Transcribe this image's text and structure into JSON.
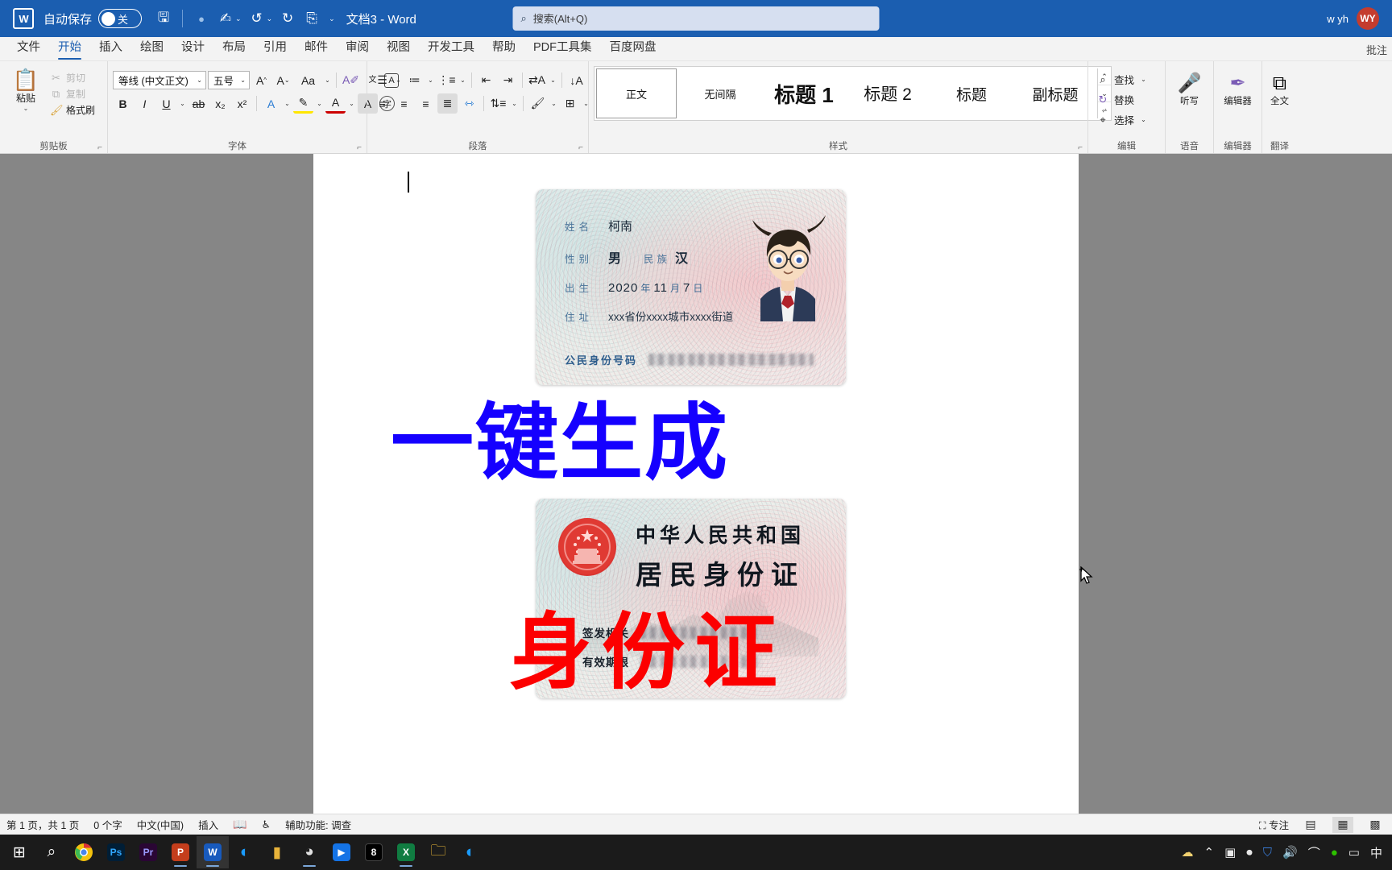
{
  "titlebar": {
    "app_icon": "word-logo-icon",
    "autosave_label": "自动保存",
    "autosave_state": "关",
    "save_icon": "save-icon",
    "undo_icon": "undo-icon",
    "redo_icon": "redo-icon",
    "touch_icon": "touch-mode-icon",
    "customize_icon": "customize-quick-access-icon",
    "doc_title": "文档3 - Word",
    "search_placeholder": "搜索(Alt+Q)",
    "search_value": "",
    "search_icon": "search-icon",
    "user_name": "w yh",
    "user_initials": "WY",
    "bg_color": "#1b5eb0"
  },
  "tabs": [
    {
      "label": "文件",
      "active": false
    },
    {
      "label": "开始",
      "active": true
    },
    {
      "label": "插入",
      "active": false
    },
    {
      "label": "绘图",
      "active": false
    },
    {
      "label": "设计",
      "active": false
    },
    {
      "label": "布局",
      "active": false
    },
    {
      "label": "引用",
      "active": false
    },
    {
      "label": "邮件",
      "active": false
    },
    {
      "label": "审阅",
      "active": false
    },
    {
      "label": "视图",
      "active": false
    },
    {
      "label": "开发工具",
      "active": false
    },
    {
      "label": "帮助",
      "active": false
    },
    {
      "label": "PDF工具集",
      "active": false
    },
    {
      "label": "百度网盘",
      "active": false
    }
  ],
  "tabs_right": {
    "comments_label": "批注"
  },
  "ribbon": {
    "clipboard": {
      "group_label": "剪贴板",
      "paste_label": "粘贴",
      "paste_icon": "paste-icon",
      "cut_label": "剪切",
      "cut_icon": "scissors-icon",
      "copy_label": "复制",
      "copy_icon": "copy-icon",
      "format_painter_label": "格式刷",
      "format_painter_icon": "format-painter-icon",
      "dialog_launcher": "⌟"
    },
    "font": {
      "group_label": "字体",
      "font_name": "等线 (中文正文)",
      "font_size": "五号",
      "grow_icon": "grow-font-icon",
      "shrink_icon": "shrink-font-icon",
      "change_case_icon": "change-case-icon",
      "clear_format_icon": "clear-formatting-icon",
      "phonetic_icon": "phonetic-guide-icon",
      "border_char_icon": "enclose-character-icon",
      "bold_label": "B",
      "italic_label": "I",
      "underline_label": "U",
      "strikethrough_icon": "strikethrough-icon",
      "subscript_label": "x₂",
      "superscript_label": "x²",
      "text_effects_icon": "text-effects-icon",
      "highlight_icon": "highlight-color-icon",
      "font_color_icon": "font-color-icon",
      "char_shading_icon": "character-shading-icon",
      "char_border_icon": "character-border-icon",
      "dialog_launcher": "⌟"
    },
    "paragraph": {
      "group_label": "段落",
      "bullets_icon": "bullet-list-icon",
      "numbering_icon": "numbered-list-icon",
      "multilevel_icon": "multilevel-list-icon",
      "decrease_indent_icon": "decrease-indent-icon",
      "increase_indent_icon": "increase-indent-icon",
      "cn_layout_icon": "asian-layout-icon",
      "sort_icon": "sort-icon",
      "show_marks_icon": "show-formatting-marks-icon",
      "align_left_icon": "align-left-icon",
      "align_center_icon": "align-center-icon",
      "align_right_icon": "align-right-icon",
      "justify_icon": "justify-icon",
      "distribute_icon": "distribute-icon",
      "line_spacing_icon": "line-spacing-icon",
      "shading_icon": "shading-icon",
      "borders_icon": "borders-icon",
      "dialog_launcher": "⌟"
    },
    "styles": {
      "group_label": "样式",
      "items": [
        {
          "label": "正文",
          "class": "s-zhengwen",
          "selected": true
        },
        {
          "label": "无间隔",
          "class": "s-wujiange",
          "selected": false
        },
        {
          "label": "标题 1",
          "class": "s-h1",
          "selected": false
        },
        {
          "label": "标题 2",
          "class": "s-h2",
          "selected": false
        },
        {
          "label": "标题",
          "class": "s-biaoti",
          "selected": false
        },
        {
          "label": "副标题",
          "class": "s-fubiaoti",
          "selected": false
        }
      ],
      "dialog_launcher": "⌟"
    },
    "editing": {
      "group_label": "编辑",
      "find_label": "查找",
      "find_icon": "search-icon",
      "replace_label": "替换",
      "replace_icon": "replace-icon",
      "select_label": "选择",
      "select_icon": "select-arrow-icon"
    },
    "voice": {
      "group_label": "语音",
      "dictate_label": "听写",
      "dictate_icon": "microphone-icon"
    },
    "editor": {
      "group_label": "编辑器",
      "editor_label": "编辑器",
      "editor_icon": "editor-pen-icon"
    },
    "share": {
      "group_label": "翻译",
      "share_label": "全文",
      "share_icon": "translate-icon"
    }
  },
  "document": {
    "overlay_text_1": "一键生成",
    "overlay_text_1_color": "#1500ff",
    "overlay_text_2": "身份证",
    "overlay_text_2_color": "#fc0000",
    "cursor_icon": "text-cursor-icon",
    "id_card_front": {
      "name_label": "姓名",
      "name_value": "柯南",
      "gender_label": "性别",
      "gender_value": "男",
      "ethnicity_label": "民族",
      "ethnicity_value": "汉",
      "birth_label": "出生",
      "birth_year": "2020",
      "birth_year_unit": "年",
      "birth_month": "11",
      "birth_month_unit": "月",
      "birth_day": "7",
      "birth_day_unit": "日",
      "address_label": "住址",
      "address_value": "xxx省份xxxx城市xxxx街道",
      "id_number_label": "公民身份号码",
      "id_number_value": "",
      "photo_alt": "portrait-photo"
    },
    "id_card_back": {
      "emblem_alt": "national-emblem-icon",
      "country_title": "中华人民共和国",
      "card_title": "居民身份证",
      "issuer_label": "签发机关",
      "issuer_value": "",
      "validity_label": "有效期限",
      "validity_value": ""
    }
  },
  "statusbar": {
    "page_info": "第 1 页，共 1 页",
    "word_count": "0 个字",
    "language": "中文(中国)",
    "insert_mode": "插入",
    "proofing_icon": "proofing-icon",
    "accessibility_icon": "accessibility-icon",
    "accessibility_label": "辅助功能: 调查",
    "focus_label": "专注",
    "focus_icon": "focus-icon",
    "view_read_icon": "read-mode-icon",
    "view_print_icon": "print-layout-icon",
    "view_web_icon": "web-layout-icon"
  },
  "taskbar": {
    "items": [
      {
        "name": "start-button",
        "glyph": "⊞",
        "bg": "transparent",
        "fg": "#ffffff",
        "open": false
      },
      {
        "name": "search-taskbar-icon",
        "glyph": "⌕",
        "bg": "transparent",
        "fg": "#ffffff",
        "open": false
      },
      {
        "name": "chrome-icon",
        "glyph": "◉",
        "bg": "transparent",
        "fg": "#4caf50",
        "open": false
      },
      {
        "name": "photoshop-icon",
        "glyph": "Ps",
        "bg": "#001e36",
        "fg": "#31a8ff",
        "open": false
      },
      {
        "name": "premiere-icon",
        "glyph": "Pr",
        "bg": "#2a0634",
        "fg": "#9999ff",
        "open": false
      },
      {
        "name": "powerpoint-icon",
        "glyph": "P",
        "bg": "#c43e1c",
        "fg": "#ffffff",
        "open": true
      },
      {
        "name": "word-icon",
        "glyph": "W",
        "bg": "#185abd",
        "fg": "#ffffff",
        "open": true,
        "running": true
      },
      {
        "name": "quark-browser-icon",
        "glyph": "◐",
        "bg": "transparent",
        "fg": "#1a9bfc",
        "open": false
      },
      {
        "name": "wps-icon",
        "glyph": "▮",
        "bg": "transparent",
        "fg": "#e8b33a",
        "open": false
      },
      {
        "name": "recorder-icon",
        "glyph": "◕",
        "bg": "transparent",
        "fg": "#e0e0e0",
        "open": true
      },
      {
        "name": "video-editor-icon",
        "glyph": "▶",
        "bg": "#1473e6",
        "fg": "#ffffff",
        "open": false
      },
      {
        "name": "capcut-icon",
        "glyph": "8",
        "bg": "#000000",
        "fg": "#ffffff",
        "open": false
      },
      {
        "name": "excel-icon",
        "glyph": "X",
        "bg": "#107c41",
        "fg": "#ffffff",
        "open": true
      },
      {
        "name": "file-explorer-icon",
        "glyph": "▭",
        "bg": "transparent",
        "fg": "#f7c13a",
        "open": false
      },
      {
        "name": "quark-2-icon",
        "glyph": "◐",
        "bg": "transparent",
        "fg": "#1a9bfc",
        "open": false
      }
    ],
    "tray": [
      {
        "name": "weather-icon",
        "glyph": "☁"
      },
      {
        "name": "show-hidden-icons-chevron",
        "glyph": "⌃"
      },
      {
        "name": "camera-icon",
        "glyph": "▣"
      },
      {
        "name": "microphone-tray-icon",
        "glyph": "🎤"
      },
      {
        "name": "security-shield-icon",
        "glyph": "🛡"
      },
      {
        "name": "volume-icon",
        "glyph": "🔊"
      },
      {
        "name": "network-icon",
        "glyph": "📶"
      },
      {
        "name": "wechat-icon",
        "glyph": "💬"
      },
      {
        "name": "battery-icon",
        "glyph": "▭"
      },
      {
        "name": "ime-indicator",
        "glyph": "中"
      }
    ]
  }
}
